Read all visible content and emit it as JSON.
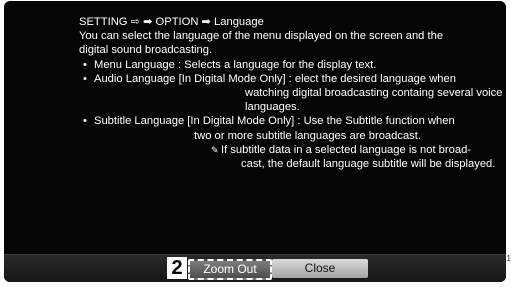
{
  "manual": {
    "path": "SETTING ⇨ ➡ OPTION ➡ Language",
    "intro_line1": "You can select the language of the menu displayed on the screen and the",
    "intro_line2": "digital sound broadcasting.",
    "bullet_symbol": "•",
    "menu_language": "Menu Language : Selects a language for the display text.",
    "audio_language_line1": "Audio Language  [In Digital Mode Only] : elect the desired language when",
    "audio_language_line2": "watching digital broadcasting containg several voice",
    "audio_language_line3": "languages.",
    "subtitle_language_line1": "Subtitle Language [In Digital Mode Only] : Use the Subtitle function when",
    "subtitle_language_line2": "two or more subtitle languages are broadcast.",
    "note_icon_glyph": "✎",
    "note_line1": "If subtitle data in a selected language is not broad-",
    "note_line2": "cast, the default language subtitle will be displayed."
  },
  "footer": {
    "step_number": "2",
    "zoom_out_label": "Zoom Out",
    "close_label": "Close"
  },
  "page_number": "1",
  "icons": {
    "note": "note-pencil-icon"
  },
  "colors": {
    "panel_background": "#050505",
    "text": "#ffffff",
    "zoom_button": "#6a6a6a",
    "close_button": "#c4c4c4"
  }
}
